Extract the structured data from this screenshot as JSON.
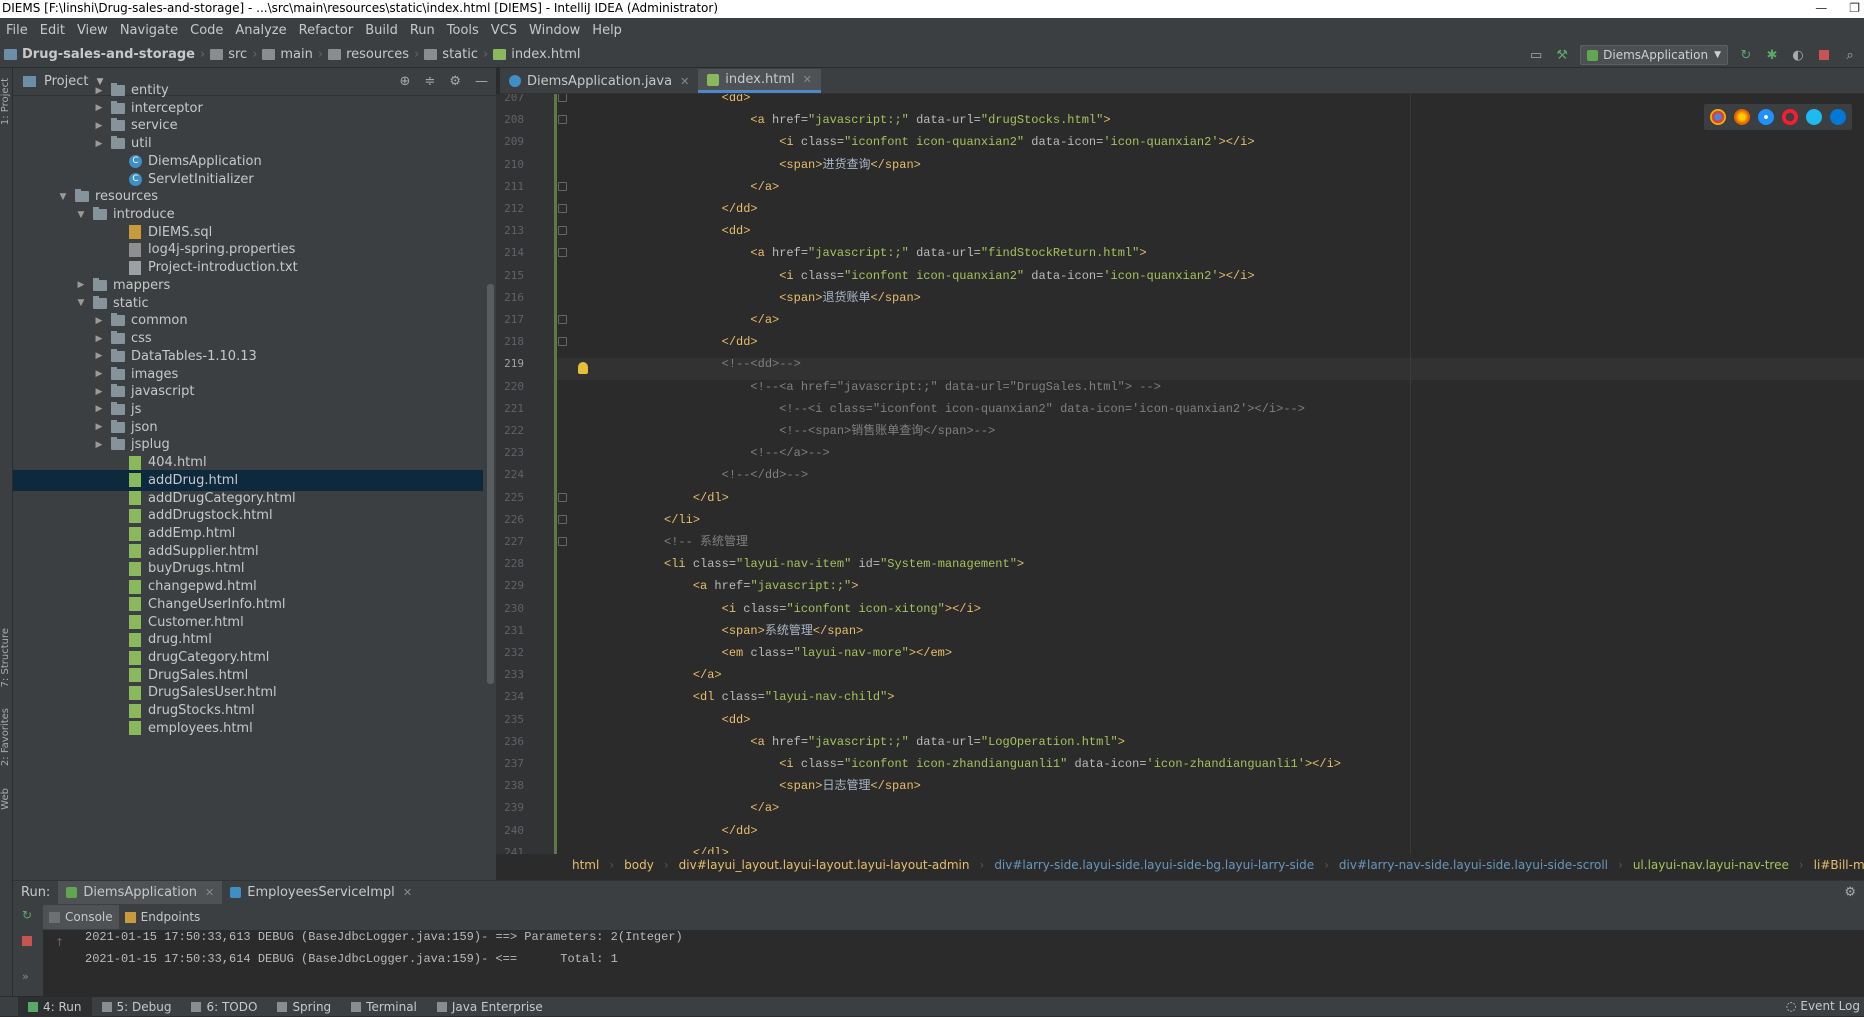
{
  "window": {
    "title": "DIEMS [F:\\linshi\\Drug-sales-and-storage] - ...\\src\\main\\resources\\static\\index.html [DIEMS] - IntelliJ IDEA (Administrator)"
  },
  "menu": [
    "File",
    "Edit",
    "View",
    "Navigate",
    "Code",
    "Analyze",
    "Refactor",
    "Build",
    "Run",
    "Tools",
    "VCS",
    "Window",
    "Help"
  ],
  "nav": {
    "crumbs": [
      "Drug-sales-and-storage",
      "src",
      "main",
      "resources",
      "static",
      "index.html"
    ],
    "run_config": "DiemsApplication"
  },
  "side_tabs": {
    "project": "1: Project",
    "structure": "7: Structure",
    "favorites": "2: Favorites",
    "web": "Web"
  },
  "project": {
    "title": "Project",
    "tree": [
      {
        "label": "entity",
        "type": "folder",
        "depth": 5,
        "arrow": "▶"
      },
      {
        "label": "interceptor",
        "type": "folder",
        "depth": 5,
        "arrow": "▶"
      },
      {
        "label": "service",
        "type": "folder",
        "depth": 5,
        "arrow": "▶"
      },
      {
        "label": "util",
        "type": "folder",
        "depth": 5,
        "arrow": "▶"
      },
      {
        "label": "DiemsApplication",
        "type": "class",
        "depth": 6,
        "arrow": ""
      },
      {
        "label": "ServletInitializer",
        "type": "class",
        "depth": 6,
        "arrow": ""
      },
      {
        "label": "resources",
        "type": "folder",
        "depth": 3,
        "arrow": "▼"
      },
      {
        "label": "introduce",
        "type": "folder",
        "depth": 4,
        "arrow": "▼"
      },
      {
        "label": "DIEMS.sql",
        "type": "sql",
        "depth": 6,
        "arrow": ""
      },
      {
        "label": "log4j-spring.properties",
        "type": "prop",
        "depth": 6,
        "arrow": ""
      },
      {
        "label": "Project-introduction.txt",
        "type": "txt",
        "depth": 6,
        "arrow": ""
      },
      {
        "label": "mappers",
        "type": "folder",
        "depth": 4,
        "arrow": "▶"
      },
      {
        "label": "static",
        "type": "folder",
        "depth": 4,
        "arrow": "▼"
      },
      {
        "label": "common",
        "type": "folder",
        "depth": 5,
        "arrow": "▶"
      },
      {
        "label": "css",
        "type": "folder",
        "depth": 5,
        "arrow": "▶"
      },
      {
        "label": "DataTables-1.10.13",
        "type": "folder",
        "depth": 5,
        "arrow": "▶"
      },
      {
        "label": "images",
        "type": "folder",
        "depth": 5,
        "arrow": "▶"
      },
      {
        "label": "javascript",
        "type": "folder",
        "depth": 5,
        "arrow": "▶"
      },
      {
        "label": "js",
        "type": "folder",
        "depth": 5,
        "arrow": "▶"
      },
      {
        "label": "json",
        "type": "folder",
        "depth": 5,
        "arrow": "▶"
      },
      {
        "label": "jsplug",
        "type": "folder",
        "depth": 5,
        "arrow": "▶"
      },
      {
        "label": "404.html",
        "type": "html",
        "depth": 6,
        "arrow": ""
      },
      {
        "label": "addDrug.html",
        "type": "html",
        "depth": 6,
        "arrow": "",
        "selected": true
      },
      {
        "label": "addDrugCategory.html",
        "type": "html",
        "depth": 6,
        "arrow": ""
      },
      {
        "label": "addDrugstock.html",
        "type": "html",
        "depth": 6,
        "arrow": ""
      },
      {
        "label": "addEmp.html",
        "type": "html",
        "depth": 6,
        "arrow": ""
      },
      {
        "label": "addSupplier.html",
        "type": "html",
        "depth": 6,
        "arrow": ""
      },
      {
        "label": "buyDrugs.html",
        "type": "html",
        "depth": 6,
        "arrow": ""
      },
      {
        "label": "changepwd.html",
        "type": "html",
        "depth": 6,
        "arrow": ""
      },
      {
        "label": "ChangeUserInfo.html",
        "type": "html",
        "depth": 6,
        "arrow": ""
      },
      {
        "label": "Customer.html",
        "type": "html",
        "depth": 6,
        "arrow": ""
      },
      {
        "label": "drug.html",
        "type": "html",
        "depth": 6,
        "arrow": ""
      },
      {
        "label": "drugCategory.html",
        "type": "html",
        "depth": 6,
        "arrow": ""
      },
      {
        "label": "DrugSales.html",
        "type": "html",
        "depth": 6,
        "arrow": ""
      },
      {
        "label": "DrugSalesUser.html",
        "type": "html",
        "depth": 6,
        "arrow": ""
      },
      {
        "label": "drugStocks.html",
        "type": "html",
        "depth": 6,
        "arrow": ""
      },
      {
        "label": "employees.html",
        "type": "html",
        "depth": 6,
        "arrow": ""
      }
    ]
  },
  "editor_tabs": [
    {
      "label": "DiemsApplication.java",
      "active": false
    },
    {
      "label": "index.html",
      "active": true
    }
  ],
  "editor": {
    "current_line": 219,
    "lines": [
      {
        "n": 207,
        "parts": [
          [
            "tag",
            "                  <dd>"
          ]
        ]
      },
      {
        "n": 208,
        "parts": [
          [
            "tag",
            "                      <a "
          ],
          [
            "attr",
            "href="
          ],
          [
            "str",
            "\"javascript:;\""
          ],
          [
            "attr",
            " data-url="
          ],
          [
            "str",
            "\"drugStocks.html\""
          ],
          [
            "tag",
            ">"
          ]
        ]
      },
      {
        "n": 209,
        "parts": [
          [
            "tag",
            "                          <i "
          ],
          [
            "attr",
            "class="
          ],
          [
            "str",
            "\"iconfont icon-quanxian2\""
          ],
          [
            "attr",
            " data-icon="
          ],
          [
            "str",
            "'icon-quanxian2'"
          ],
          [
            "tag",
            "></i>"
          ]
        ]
      },
      {
        "n": 210,
        "parts": [
          [
            "tag",
            "                          <span>"
          ],
          [
            "txt",
            "进货查询"
          ],
          [
            "tag",
            "</span>"
          ]
        ]
      },
      {
        "n": 211,
        "parts": [
          [
            "tag",
            "                      </a>"
          ]
        ]
      },
      {
        "n": 212,
        "parts": [
          [
            "tag",
            "                  </dd>"
          ]
        ]
      },
      {
        "n": 213,
        "parts": [
          [
            "tag",
            "                  <dd>"
          ]
        ]
      },
      {
        "n": 214,
        "parts": [
          [
            "tag",
            "                      <a "
          ],
          [
            "attr",
            "href="
          ],
          [
            "str",
            "\"javascript:;\""
          ],
          [
            "attr",
            " data-url="
          ],
          [
            "str",
            "\"findStockReturn.html\""
          ],
          [
            "tag",
            ">"
          ]
        ]
      },
      {
        "n": 215,
        "parts": [
          [
            "tag",
            "                          <i "
          ],
          [
            "attr",
            "class="
          ],
          [
            "str",
            "\"iconfont icon-quanxian2\""
          ],
          [
            "attr",
            " data-icon="
          ],
          [
            "str",
            "'icon-quanxian2'"
          ],
          [
            "tag",
            "></i>"
          ]
        ]
      },
      {
        "n": 216,
        "parts": [
          [
            "tag",
            "                          <span>"
          ],
          [
            "txt",
            "退货账单"
          ],
          [
            "tag",
            "</span>"
          ]
        ]
      },
      {
        "n": 217,
        "parts": [
          [
            "tag",
            "                      </a>"
          ]
        ]
      },
      {
        "n": 218,
        "parts": [
          [
            "tag",
            "                  </dd>"
          ]
        ]
      },
      {
        "n": 219,
        "parts": [
          [
            "cmt",
            "                  <!--<dd>-->"
          ]
        ]
      },
      {
        "n": 220,
        "parts": [
          [
            "cmt",
            "                      <!--<a href=\"javascript:;\" data-url=\"DrugSales.html\"> -->"
          ]
        ]
      },
      {
        "n": 221,
        "parts": [
          [
            "cmt",
            "                          <!--<i class=\"iconfont icon-quanxian2\" data-icon='icon-quanxian2'></i>-->"
          ]
        ]
      },
      {
        "n": 222,
        "parts": [
          [
            "cmt",
            "                          <!--<span>销售账单查询</span>-->"
          ]
        ]
      },
      {
        "n": 223,
        "parts": [
          [
            "cmt",
            "                      <!--</a>-->"
          ]
        ]
      },
      {
        "n": 224,
        "parts": [
          [
            "cmt",
            "                  <!--</dd>-->"
          ]
        ]
      },
      {
        "n": 225,
        "parts": [
          [
            "tag",
            "              </dl>"
          ]
        ]
      },
      {
        "n": 226,
        "parts": [
          [
            "tag",
            "          </li>"
          ]
        ]
      },
      {
        "n": 227,
        "parts": [
          [
            "cmt",
            "          <!-- 系统管理"
          ]
        ]
      },
      {
        "n": 228,
        "parts": [
          [
            "tag",
            "          <li "
          ],
          [
            "attr",
            "class="
          ],
          [
            "str",
            "\"layui-nav-item\""
          ],
          [
            "attr",
            " id="
          ],
          [
            "str",
            "\"System-management\""
          ],
          [
            "tag",
            ">"
          ]
        ]
      },
      {
        "n": 229,
        "parts": [
          [
            "tag",
            "              <a "
          ],
          [
            "attr",
            "href="
          ],
          [
            "str",
            "\"javascript:;\""
          ],
          [
            "tag",
            ">"
          ]
        ]
      },
      {
        "n": 230,
        "parts": [
          [
            "tag",
            "                  <i "
          ],
          [
            "attr",
            "class="
          ],
          [
            "str",
            "\"iconfont icon-xitong\""
          ],
          [
            "tag",
            "></i>"
          ]
        ]
      },
      {
        "n": 231,
        "parts": [
          [
            "tag",
            "                  <span>"
          ],
          [
            "txt",
            "系统管理"
          ],
          [
            "tag",
            "</span>"
          ]
        ]
      },
      {
        "n": 232,
        "parts": [
          [
            "tag",
            "                  <em "
          ],
          [
            "attr",
            "class="
          ],
          [
            "str",
            "\"layui-nav-more\""
          ],
          [
            "tag",
            "></em>"
          ]
        ]
      },
      {
        "n": 233,
        "parts": [
          [
            "tag",
            "              </a>"
          ]
        ]
      },
      {
        "n": 234,
        "parts": [
          [
            "tag",
            "              <dl "
          ],
          [
            "attr",
            "class="
          ],
          [
            "str",
            "\"layui-nav-child\""
          ],
          [
            "tag",
            ">"
          ]
        ]
      },
      {
        "n": 235,
        "parts": [
          [
            "tag",
            "                  <dd>"
          ]
        ]
      },
      {
        "n": 236,
        "parts": [
          [
            "tag",
            "                      <a "
          ],
          [
            "attr",
            "href="
          ],
          [
            "str",
            "\"javascript:;\""
          ],
          [
            "attr",
            " data-url="
          ],
          [
            "str",
            "\"LogOperation.html\""
          ],
          [
            "tag",
            ">"
          ]
        ]
      },
      {
        "n": 237,
        "parts": [
          [
            "tag",
            "                          <i "
          ],
          [
            "attr",
            "class="
          ],
          [
            "str",
            "\"iconfont icon-zhandianguanli1\""
          ],
          [
            "attr",
            " data-icon="
          ],
          [
            "str",
            "'icon-zhandianguanli1'"
          ],
          [
            "tag",
            "></i>"
          ]
        ]
      },
      {
        "n": 238,
        "parts": [
          [
            "tag",
            "                          <span>"
          ],
          [
            "txt",
            "日志管理"
          ],
          [
            "tag",
            "</span>"
          ]
        ]
      },
      {
        "n": 239,
        "parts": [
          [
            "tag",
            "                      </a>"
          ]
        ]
      },
      {
        "n": 240,
        "parts": [
          [
            "tag",
            "                  </dd>"
          ]
        ]
      },
      {
        "n": 241,
        "parts": [
          [
            "tag",
            "              </dl>"
          ]
        ]
      }
    ]
  },
  "breadcrumbs": [
    "html",
    "body",
    "div#layui_layout.layui-layout.layui-layout-admin",
    "div#larry-side.layui-side.layui-side-bg.layui-larry-side",
    "div#larry-nav-side.layui-side.layui-side-scroll",
    "ul.layui-nav.layui-nav-tree",
    "li#Bill-management.layui-nav"
  ],
  "run": {
    "label": "Run:",
    "tabs": [
      {
        "label": "DiemsApplication",
        "active": true
      },
      {
        "label": "EmployeesServiceImpl",
        "active": false
      }
    ],
    "sub_tabs": [
      "Console",
      "Endpoints"
    ],
    "console": [
      "2021-01-15 17:50:33,613 DEBUG (BaseJdbcLogger.java:159)- ==> Parameters: 2(Integer)",
      "2021-01-15 17:50:33,614 DEBUG (BaseJdbcLogger.java:159)- <==      Total: 1"
    ]
  },
  "status": {
    "tools": [
      "4: Run",
      "5: Debug",
      "6: TODO",
      "Spring",
      "Terminal",
      "Java Enterprise"
    ],
    "event_log": "Event Log"
  },
  "colors": {
    "accent": "#4a88c7",
    "selection": "#0d293e",
    "vcs_changed": "#5c7a41"
  }
}
